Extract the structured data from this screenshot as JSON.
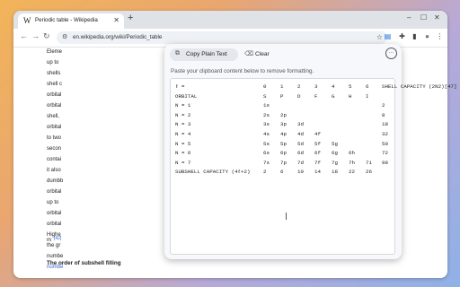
{
  "browser": {
    "tab": {
      "favicon": "W",
      "title": "Periodic table - Wikipedia",
      "close": "✕"
    },
    "new_tab": "+",
    "window_controls": [
      "–",
      "☐",
      "✕"
    ],
    "nav": {
      "back": "←",
      "forward": "→",
      "reload": "↻"
    },
    "omnibox": {
      "site_info": "⚙",
      "url": "en.wikipedia.org/wiki/Periodic_table",
      "star": "☆"
    },
    "toolbar_icons": {
      "reading": "▤",
      "extensions": "✚",
      "sidepanel": "▮",
      "profile": "●",
      "menu": "⋮"
    }
  },
  "article": {
    "lines": [
      "Eleme",
      "up to",
      "shells",
      "shell c",
      "orbital",
      "orbital",
      "shell,",
      "orbital",
      "to two",
      "secon",
      "contai",
      "it also",
      "dumbb",
      "orbital",
      "up to",
      "orbital",
      "orbital",
      "Highe",
      "the gr",
      "numbe",
      "numbe",
      "m",
      "[42]"
    ],
    "subheading": "The order of subshell filling"
  },
  "panel": {
    "copy_button": "Copy Plain Text",
    "clear_button": "Clear",
    "more": "···",
    "instruction": "Paste your clipboard content below to remove formatting.",
    "table": {
      "header": [
        "ℓ =",
        "0",
        "1",
        "2",
        "3",
        "4",
        "5",
        "6",
        "SHELL CAPACITY (2N2)[47]"
      ],
      "rows": [
        [
          "ORBITAL",
          "S",
          "P",
          "D",
          "F",
          "G",
          "H",
          "I",
          ""
        ],
        [
          "N = 1",
          "1s",
          "",
          "",
          "",
          "",
          "",
          "",
          "2"
        ],
        [
          "N = 2",
          "2s",
          "2p",
          "",
          "",
          "",
          "",
          "",
          "8"
        ],
        [
          "N = 3",
          "3s",
          "3p",
          "3d",
          "",
          "",
          "",
          "",
          "18"
        ],
        [
          "N = 4",
          "4s",
          "4p",
          "4d",
          "4f",
          "",
          "",
          "",
          "32"
        ],
        [
          "N = 5",
          "5s",
          "5p",
          "5d",
          "5f",
          "5g",
          "",
          "",
          "50"
        ],
        [
          "N = 6",
          "6s",
          "6p",
          "6d",
          "6f",
          "6g",
          "6h",
          "",
          "72"
        ],
        [
          "N = 7",
          "7s",
          "7p",
          "7d",
          "7f",
          "7g",
          "7h",
          "7i",
          "98"
        ],
        [
          "SUBSHELL CAPACITY (4ℓ+2)",
          "2",
          "6",
          "10",
          "14",
          "18",
          "22",
          "26",
          ""
        ]
      ]
    }
  }
}
